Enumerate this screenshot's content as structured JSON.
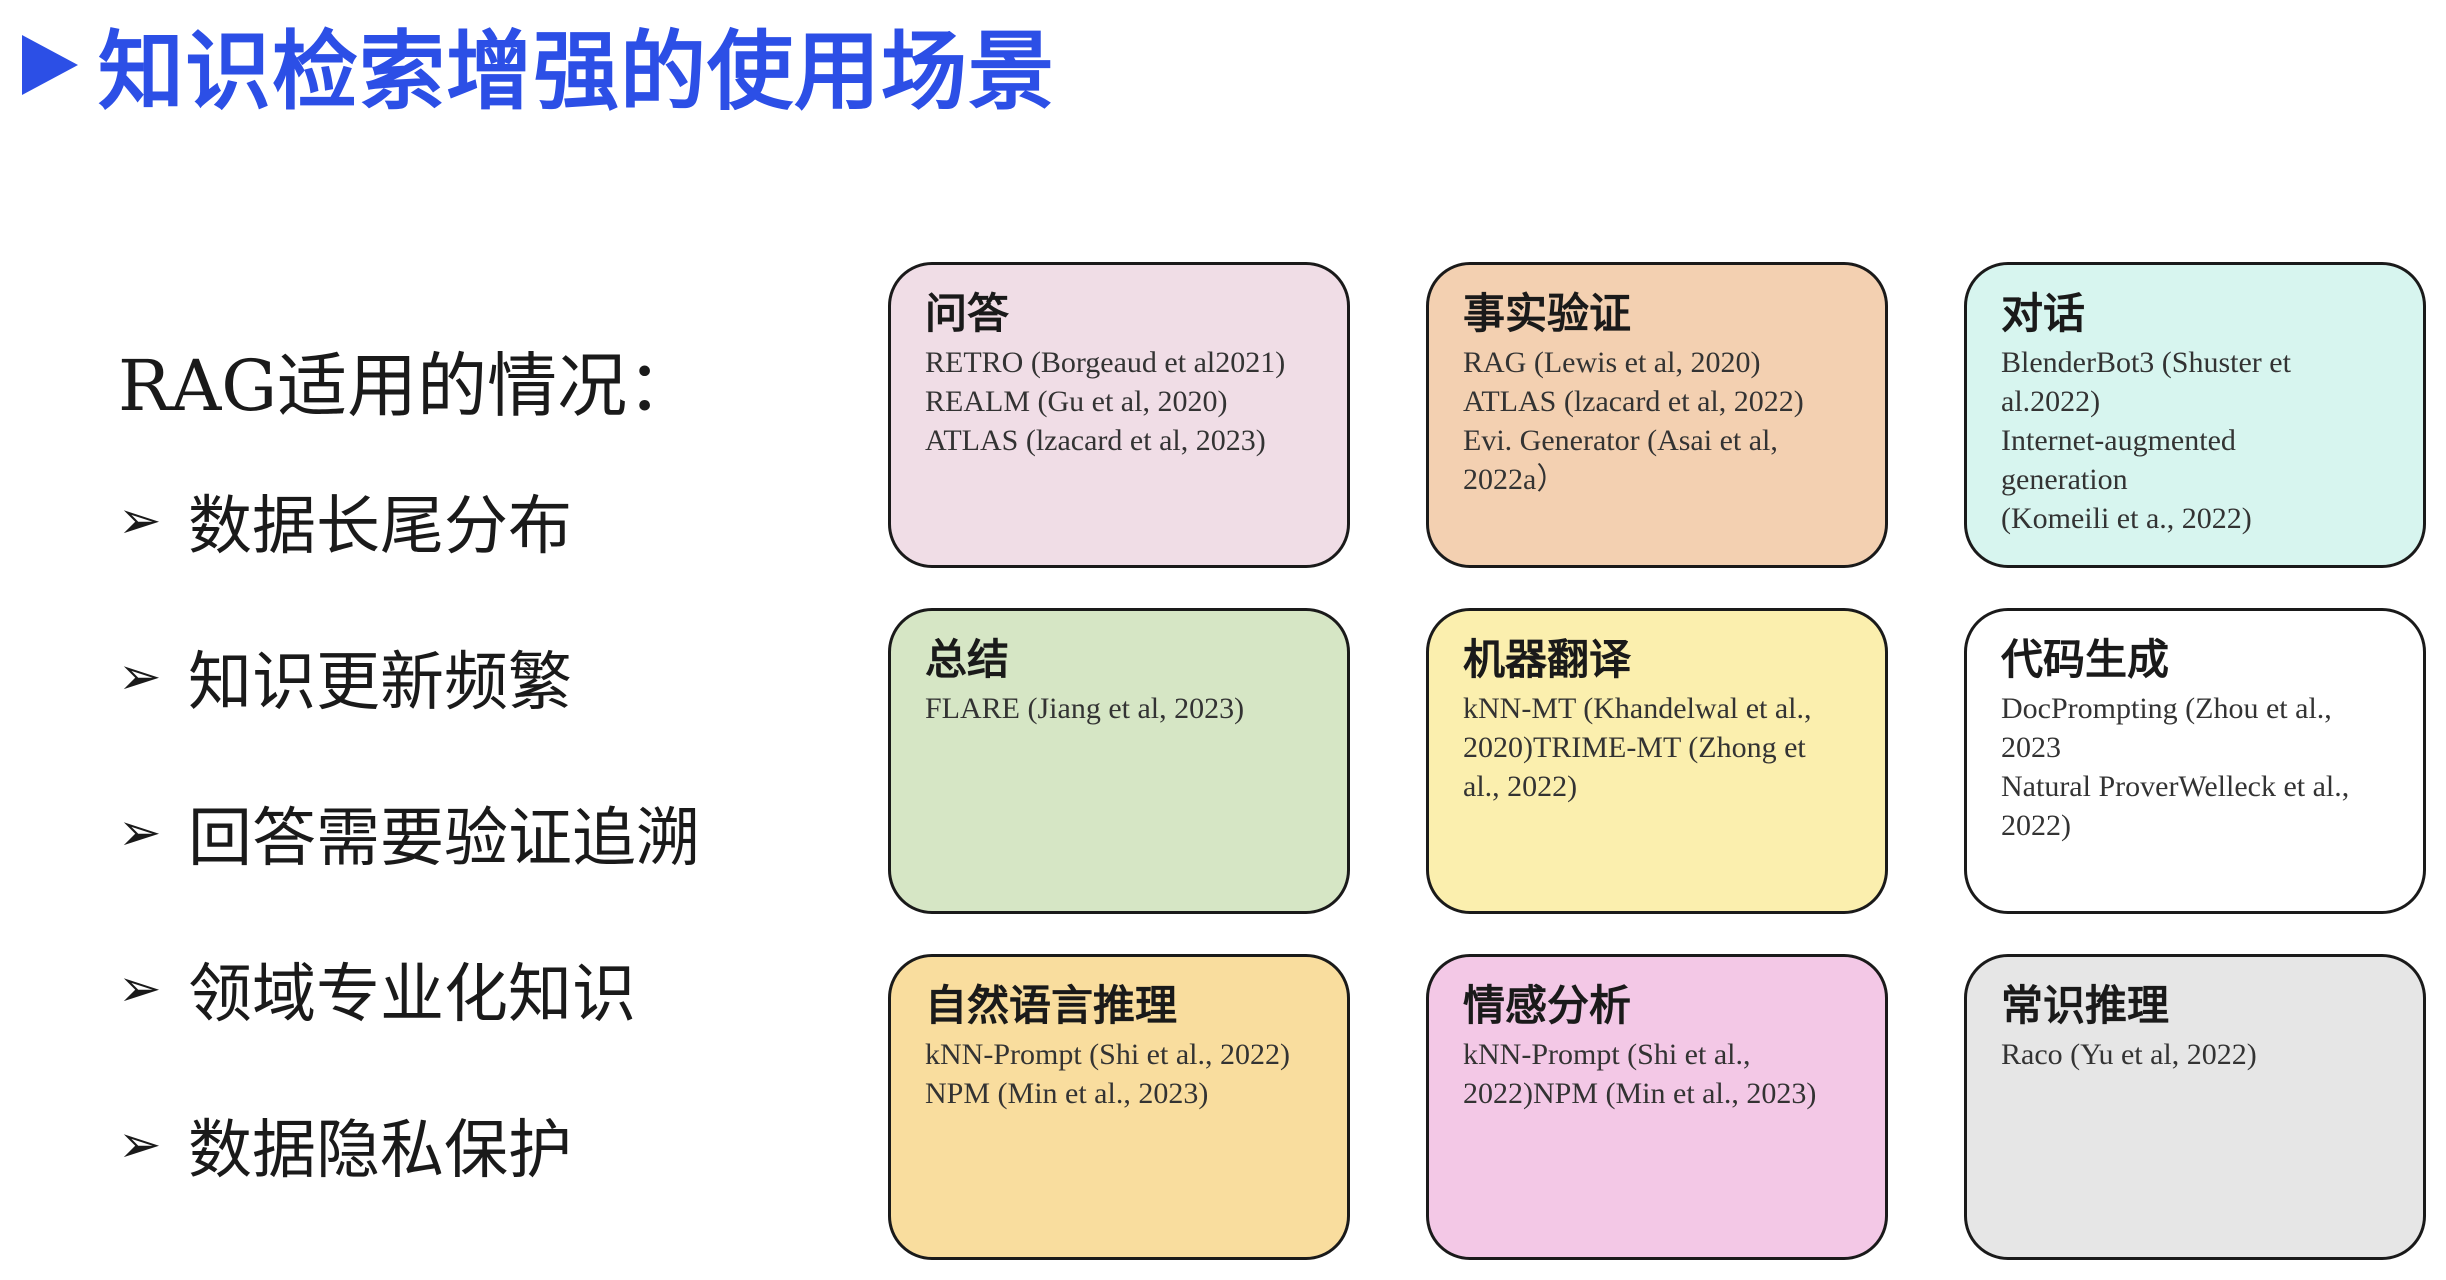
{
  "title": "知识检索增强的使用场景",
  "colors": {
    "title": "#2c4fe6",
    "card_border": "#1a1a1a"
  },
  "left": {
    "heading": "RAG适用的情况：",
    "bullet_icon": "arrow-bullet-icon",
    "bullets": [
      "数据长尾分布",
      "知识更新频繁",
      "回答需要验证追溯",
      "领域专业化知识",
      "数据隐私保护"
    ]
  },
  "cards": [
    {
      "title": "问答",
      "color": "#f0dde6",
      "lines": [
        "RETRO (Borgeaud et al2021)",
        "REALM (Gu et al, 2020)",
        "ATLAS (lzacard et al, 2023)"
      ]
    },
    {
      "title": "事实验证",
      "color": "#f3d0b1",
      "lines": [
        "RAG (Lewis et al, 2020)",
        "ATLAS (lzacard et al, 2022)",
        "Evi. Generator (Asai et al,",
        "2022a）"
      ]
    },
    {
      "title": "对话",
      "color": "#d7f5ef",
      "lines": [
        "BlenderBot3 (Shuster et",
        "al.2022)",
        "Internet-augmented",
        "generation",
        "(Komeili et a., 2022)"
      ]
    },
    {
      "title": "总结",
      "color": "#d6e6c5",
      "lines": [
        "FLARE (Jiang et al, 2023)"
      ]
    },
    {
      "title": "机器翻译",
      "color": "#fbefae",
      "lines": [
        "kNN-MT (Khandelwal et al.,",
        "2020)TRIME-MT (Zhong et",
        "al., 2022)"
      ]
    },
    {
      "title": "代码生成",
      "color": "#ffffff",
      "lines": [
        "DocPrompting (Zhou et al.,",
        "2023",
        "Natural ProverWelleck et al.,",
        "2022)"
      ]
    },
    {
      "title": "自然语言推理",
      "color": "#f9dd9e",
      "lines": [
        "kNN-Prompt (Shi et al., 2022)",
        "NPM (Min et al., 2023)"
      ]
    },
    {
      "title": "情感分析",
      "color": "#f3c8e6",
      "lines": [
        "kNN-Prompt (Shi et al.,",
        "2022)NPM (Min et al., 2023)"
      ]
    },
    {
      "title": "常识推理",
      "color": "#e6e6e6",
      "lines": [
        "Raco (Yu et al, 2022)"
      ]
    }
  ]
}
